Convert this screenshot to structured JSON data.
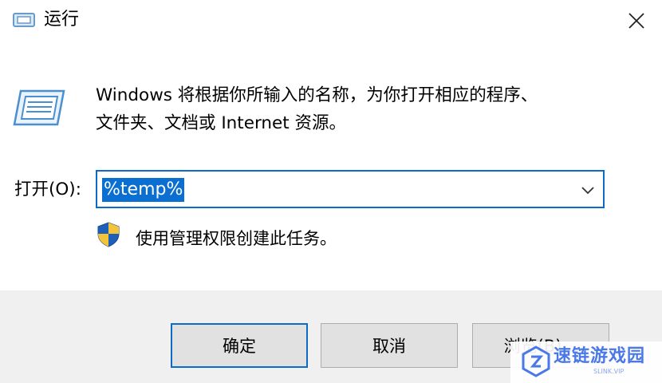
{
  "window": {
    "title": "运行"
  },
  "dialog": {
    "description_line1": "Windows 将根据你所输入的名称，为你打开相应的程序、",
    "description_line2": "文件夹、文档或 Internet 资源。",
    "open_label": "打开(O):",
    "open_value": "%temp%",
    "admin_note": "使用管理权限创建此任务。"
  },
  "buttons": {
    "ok": "确定",
    "cancel": "取消",
    "browse": "浏览(B)..."
  },
  "watermark": {
    "text": "速链游戏园",
    "subtext": "SLINK.VIP"
  },
  "colors": {
    "accent": "#0b6bc6",
    "selection": "#0b6fd1",
    "footer_bg": "#f0f0f0",
    "button_bg": "#e1e1e1",
    "watermark": "#4a78e6"
  }
}
